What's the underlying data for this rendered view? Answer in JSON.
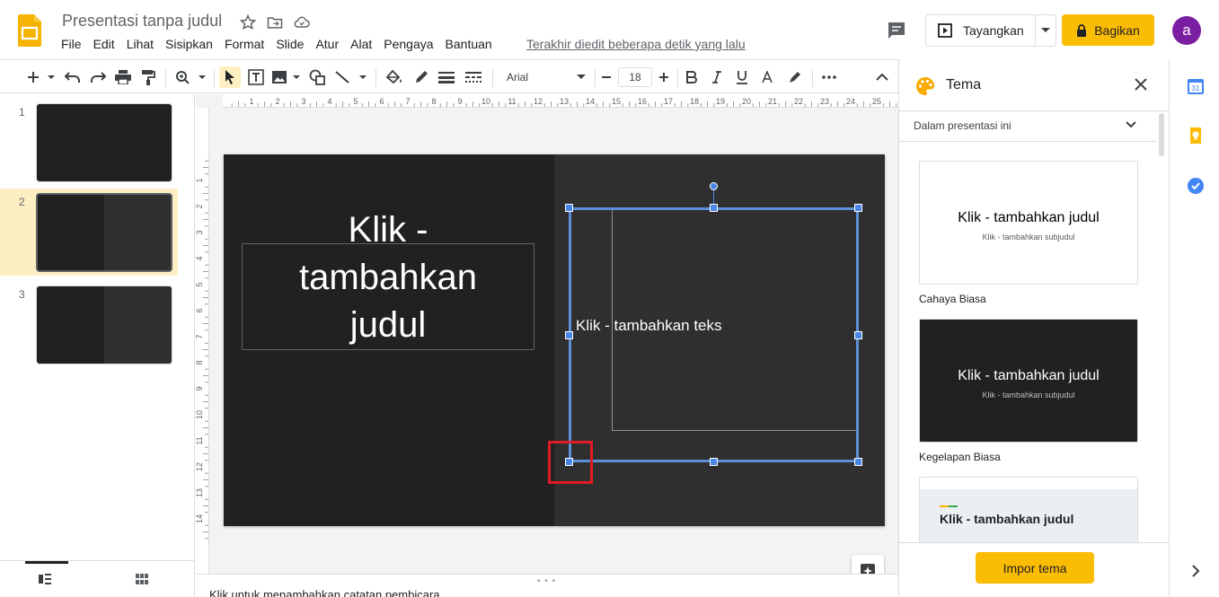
{
  "header": {
    "doc_title": "Presentasi tanpa judul",
    "menu": [
      "File",
      "Edit",
      "Lihat",
      "Sisipkan",
      "Format",
      "Slide",
      "Atur",
      "Alat",
      "Pengaya",
      "Bantuan"
    ],
    "last_edit": "Terakhir diedit beberapa detik yang lalu",
    "present_label": "Tayangkan",
    "share_label": "Bagikan",
    "avatar_letter": "a"
  },
  "toolbar": {
    "font_name": "Arial",
    "font_size": "18"
  },
  "filmstrip": {
    "slides": [
      {
        "number": "1",
        "layout": "title"
      },
      {
        "number": "2",
        "layout": "split",
        "selected": true
      },
      {
        "number": "3",
        "layout": "split"
      }
    ]
  },
  "rulers": {
    "horizontal_labels": [
      "1",
      "2",
      "3",
      "4",
      "5",
      "6",
      "7",
      "8",
      "9",
      "10",
      "11",
      "12",
      "13",
      "14",
      "15",
      "16",
      "17",
      "18",
      "19",
      "20",
      "21",
      "22",
      "23",
      "24",
      "25"
    ],
    "vertical_labels": [
      "1",
      "2",
      "3",
      "4",
      "5",
      "6",
      "7",
      "8",
      "9",
      "10",
      "11",
      "12",
      "13",
      "14"
    ]
  },
  "slide": {
    "title_line1": "Klik -",
    "title_line2": "tambahkan",
    "title_line3": "judul",
    "body_text": "Klik - tambahkan teks"
  },
  "notes": {
    "text": "Klik untuk menambahkan catatan pembicara"
  },
  "theme_panel": {
    "title": "Tema",
    "scope": "Dalam presentasi ini",
    "themes": [
      {
        "name": "Cahaya Biasa",
        "preview_title": "Klik - tambahkan judul",
        "preview_subtitle": "Klik - tambahkan subjudul",
        "bg": "#ffffff",
        "fg": "#000000"
      },
      {
        "name": "Kegelapan Biasa",
        "preview_title": "Klik - tambahkan judul",
        "preview_subtitle": "Klik - tambahkan subjudul",
        "bg": "#212121",
        "fg": "#ffffff"
      },
      {
        "name": "",
        "preview_title": "Klik - tambahkan judul",
        "preview_subtitle": "",
        "bg": "#eceff1",
        "fg": "#202124"
      }
    ],
    "import_label": "Impor tema"
  },
  "colors": {
    "accent_yellow": "#fbbc04",
    "selection_blue": "#4a86e8",
    "slide_dark": "#212121",
    "slide_dark_alt": "#2f2f2f",
    "highlight_red": "#e01b24"
  }
}
